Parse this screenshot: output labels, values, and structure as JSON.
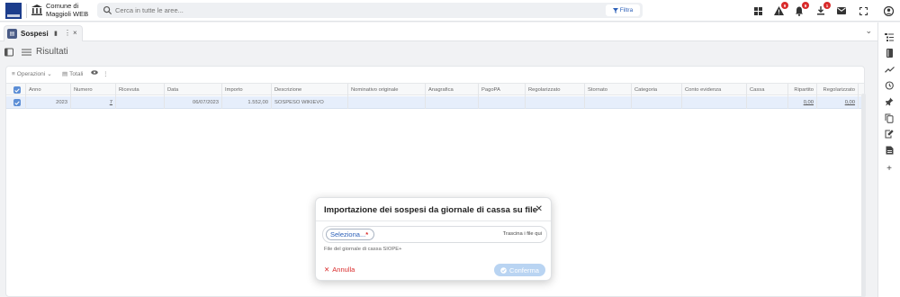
{
  "header": {
    "org_name_line1": "Comune di",
    "org_name_line2": "Maggioli WEB",
    "search_placeholder": "Cerca in tutte le aree...",
    "filter_label": "Filtra",
    "badges": {
      "alerts": "9",
      "notifications": "9",
      "downloads": "1"
    }
  },
  "tabs": {
    "active_label": "Sospesi"
  },
  "page": {
    "title": "Risultati"
  },
  "grid": {
    "toolbar": {
      "operations_label": "Operazioni",
      "totals_label": "Totali"
    },
    "columns": [
      "Anno",
      "Numero",
      "Ricevuta",
      "Data",
      "Importo",
      "Descrizione",
      "Nominativo originale",
      "Anagrafica",
      "PagoPA",
      "Regolarizzato",
      "Stornato",
      "Categoria",
      "Conto evidenza",
      "Cassa",
      "Ripartito",
      "Regolarizzato"
    ],
    "rows": [
      {
        "anno": "2023",
        "numero": "7",
        "ricevuta": "",
        "data": "06/07/2023",
        "importo": "1.552,00",
        "descrizione": "SOSPESO WIKIEVO",
        "nominativo": "",
        "anagrafica": "",
        "pagopa": "",
        "regolarizzato": "",
        "stornato": "",
        "categoria": "",
        "conto": "",
        "cassa": "",
        "ripartito": "0,00",
        "regolarizzato_amt": "0,00"
      }
    ]
  },
  "modal": {
    "title": "Importazione dei sospesi da giornale di cassa su file",
    "select_label": "Seleziona...",
    "required_mark": "*",
    "drop_hint": "Trascina i file qui",
    "caption": "File del giornale di cassa SIOPE+",
    "cancel_label": "Annulla",
    "confirm_label": "Conferma"
  },
  "colors": {
    "accent": "#2b5fb8",
    "danger": "#d92b2b",
    "selected_row": "#e6eefb",
    "confirm_disabled": "#b9d4f2"
  }
}
